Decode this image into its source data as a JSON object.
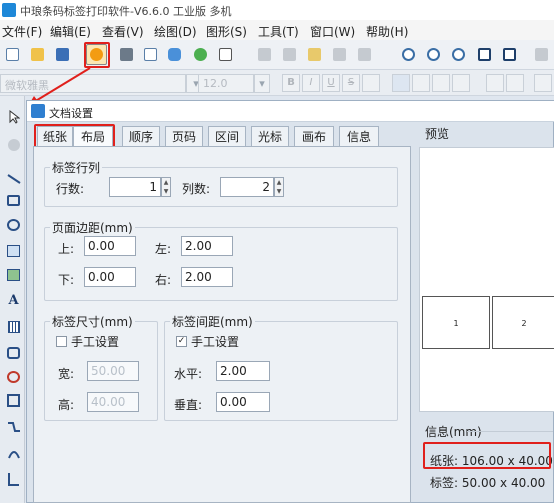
{
  "window": {
    "title": "中琅条码标签打印软件-V6.6.0 工业版 多机"
  },
  "menu": [
    {
      "label": "文件(F)"
    },
    {
      "label": "编辑(E)"
    },
    {
      "label": "查看(V)"
    },
    {
      "label": "绘图(D)"
    },
    {
      "label": "图形(S)"
    },
    {
      "label": "工具(T)"
    },
    {
      "label": "窗口(W)"
    },
    {
      "label": "帮助(H)"
    }
  ],
  "font_toolbar": {
    "font": "微软雅黑",
    "size": "12.0",
    "bold": "B",
    "italic": "I",
    "underline": "U",
    "strike": "S"
  },
  "dialog": {
    "title": "文档设置",
    "tabs": [
      {
        "label": "纸张"
      },
      {
        "label": "布局"
      },
      {
        "label": "顺序"
      },
      {
        "label": "页码"
      },
      {
        "label": "区间"
      },
      {
        "label": "光标"
      },
      {
        "label": "画布"
      },
      {
        "label": "信息"
      }
    ],
    "label_rowcol": {
      "legend": "标签行列",
      "rows_label": "行数:",
      "rows": "1",
      "cols_label": "列数:",
      "cols": "2"
    },
    "margins": {
      "legend": "页面边距(mm)",
      "top_label": "上:",
      "top": "0.00",
      "left_label": "左:",
      "left": "2.00",
      "bottom_label": "下:",
      "bottom": "0.00",
      "right_label": "右:",
      "right": "2.00"
    },
    "label_size": {
      "legend": "标签尺寸(mm)",
      "manual_label": "手工设置",
      "manual_checked": false,
      "width_label": "宽:",
      "width": "50.00",
      "height_label": "高:",
      "height": "40.00"
    },
    "label_gap": {
      "legend": "标签间距(mm)",
      "manual_label": "手工设置",
      "manual_checked": true,
      "h_label": "水平:",
      "h": "2.00",
      "v_label": "垂直:",
      "v": "0.00"
    },
    "preview": {
      "title": "预览",
      "labels": [
        "1",
        "2"
      ]
    },
    "info": {
      "title": "信息(mm)",
      "paper": "纸张: 106.00 x 40.00",
      "label": "标签: 50.00 x 40.00"
    }
  },
  "colors": {
    "highlight": "#e0201c",
    "accent": "#2f7fd0"
  }
}
